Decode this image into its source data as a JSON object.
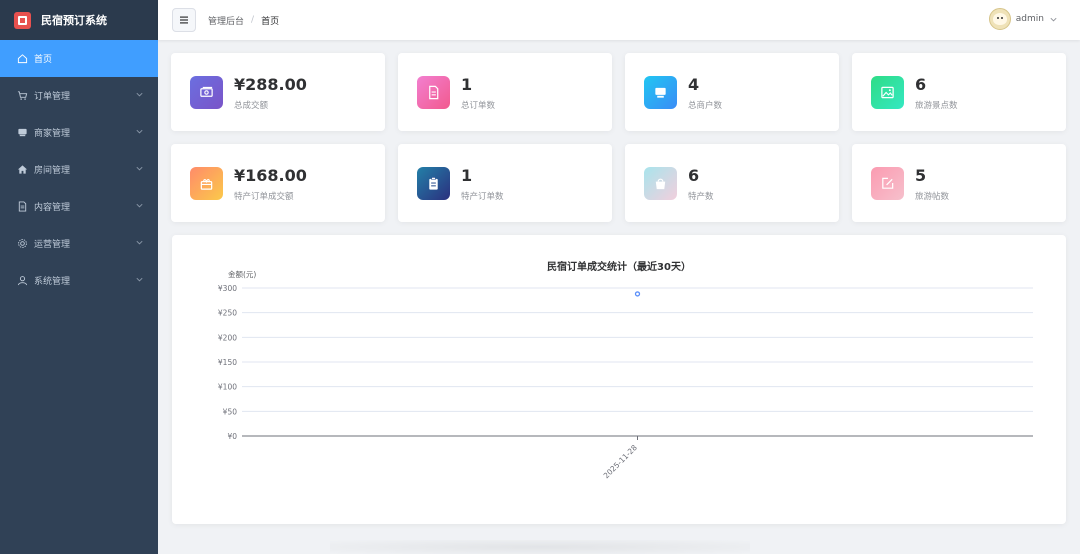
{
  "app": {
    "title": "民宿预订系统"
  },
  "sidebar": {
    "items": [
      {
        "label": "首页",
        "icon": "home-icon",
        "active": true,
        "has_children": false
      },
      {
        "label": "订单管理",
        "icon": "cart-icon",
        "active": false,
        "has_children": true
      },
      {
        "label": "商家管理",
        "icon": "shop-icon",
        "active": false,
        "has_children": true
      },
      {
        "label": "房间管理",
        "icon": "house-icon",
        "active": false,
        "has_children": true
      },
      {
        "label": "内容管理",
        "icon": "document-icon",
        "active": false,
        "has_children": true
      },
      {
        "label": "运营管理",
        "icon": "gear-icon",
        "active": false,
        "has_children": true
      },
      {
        "label": "系统管理",
        "icon": "user-icon",
        "active": false,
        "has_children": true
      }
    ]
  },
  "header": {
    "breadcrumb": {
      "root": "管理后台",
      "separator": "/",
      "current": "首页"
    },
    "user": {
      "name": "admin"
    }
  },
  "stats": [
    {
      "value": "¥288.00",
      "label": "总成交额",
      "icon": "money-icon",
      "gradient": [
        "#6b6fe0",
        "#7a54c8"
      ]
    },
    {
      "value": "1",
      "label": "总订单数",
      "icon": "order-icon",
      "gradient": [
        "#f27fd0",
        "#f25a8e"
      ]
    },
    {
      "value": "4",
      "label": "总商户数",
      "icon": "store-icon",
      "gradient": [
        "#21c6f2",
        "#3a8cf6"
      ]
    },
    {
      "value": "6",
      "label": "旅游景点数",
      "icon": "picture-icon",
      "gradient": [
        "#2fdc86",
        "#34e8c2"
      ]
    },
    {
      "value": "¥168.00",
      "label": "特产订单成交额",
      "icon": "gift-icon",
      "gradient": [
        "#ff8b6a",
        "#fbc94a"
      ]
    },
    {
      "value": "1",
      "label": "特产订单数",
      "icon": "clipboard-icon",
      "gradient": [
        "#2380a8",
        "#2b2f7e"
      ]
    },
    {
      "value": "6",
      "label": "特产数",
      "icon": "bag-icon",
      "gradient": [
        "#a8e4ec",
        "#f2cfdd"
      ]
    },
    {
      "value": "5",
      "label": "旅游帖数",
      "icon": "edit-icon",
      "gradient": [
        "#fb9bb1",
        "#f6c0cc"
      ]
    }
  ],
  "chart_data": {
    "type": "scatter",
    "title": "民宿订单成交统计（最近30天）",
    "ylabel": "金额(元)",
    "xlabel": "",
    "y_tick_labels": [
      "¥0",
      "¥50",
      "¥100",
      "¥150",
      "¥200",
      "¥250",
      "¥300"
    ],
    "ylim": [
      0,
      300
    ],
    "x_categories": [
      "2025-11-28"
    ],
    "points": [
      {
        "x": "2025-11-28",
        "y": 288
      }
    ],
    "grid": true,
    "color": "#5b8ff9"
  }
}
